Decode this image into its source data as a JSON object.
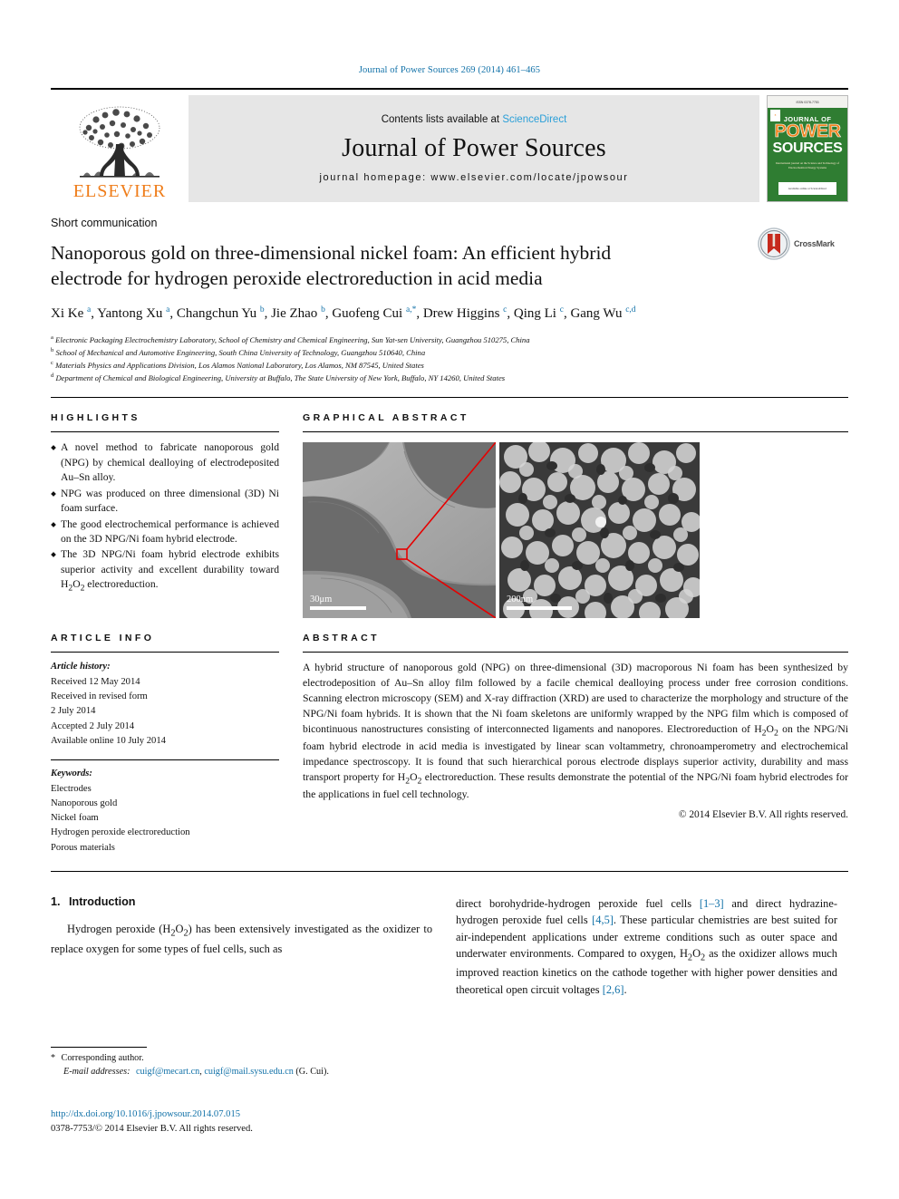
{
  "running_head": "Journal of Power Sources 269 (2014) 461–465",
  "masthead": {
    "contents_prefix": "Contents lists available at ",
    "sciencedirect": "ScienceDirect",
    "journal_name": "Journal of Power Sources",
    "homepage": "journal homepage: www.elsevier.com/locate/jpowsour",
    "publisher_logo_text": "ELSEVIER",
    "tree_icon": "elsevier-tree-icon",
    "cover": {
      "top_text": "ISSN 0378-7753",
      "line1": "JOURNAL OF",
      "line2": "POWER",
      "line3": "SOURCES",
      "blurb": "International journal on the Science and Technology of Electrochemical Energy Systems",
      "footer": "Available online at ScienceDirect"
    }
  },
  "article": {
    "doctype": "Short communication",
    "title": "Nanoporous gold on three-dimensional nickel foam: An efficient hybrid electrode for hydrogen peroxide electroreduction in acid media",
    "crossmark_label": "CrossMark",
    "authors": [
      {
        "name": "Xi Ke",
        "sup": "a",
        "sep": ", "
      },
      {
        "name": "Yantong Xu",
        "sup": "a",
        "sep": ", "
      },
      {
        "name": "Changchun Yu",
        "sup": "b",
        "sep": ", "
      },
      {
        "name": "Jie Zhao",
        "sup": "b",
        "sep": ", "
      },
      {
        "name": "Guofeng Cui",
        "sup": "a,*",
        "sep": ", "
      },
      {
        "name": "Drew Higgins",
        "sup": "c",
        "sep": ", "
      },
      {
        "name": "Qing Li",
        "sup": "c",
        "sep": ", "
      },
      {
        "name": "Gang Wu",
        "sup": "c,d",
        "sep": ""
      }
    ],
    "affiliations": [
      {
        "sup": "a",
        "text": "Electronic Packaging Electrochemistry Laboratory, School of Chemistry and Chemical Engineering, Sun Yat-sen University, Guangzhou 510275, China"
      },
      {
        "sup": "b",
        "text": "School of Mechanical and Automotive Engineering, South China University of Technology, Guangzhou 510640, China"
      },
      {
        "sup": "c",
        "text": "Materials Physics and Applications Division, Los Alamos National Laboratory, Los Alamos, NM 87545, United States"
      },
      {
        "sup": "d",
        "text": "Department of Chemical and Biological Engineering, University at Buffalo, The State University of New York, Buffalo, NY 14260, United States"
      }
    ]
  },
  "highlights": {
    "heading": "HIGHLIGHTS",
    "items": [
      "A novel method to fabricate nanoporous gold (NPG) by chemical dealloying of electrodeposited Au–Sn alloy.",
      "NPG was produced on three dimensional (3D) Ni foam surface.",
      "The good electrochemical performance is achieved on the 3D NPG/Ni foam hybrid electrode.",
      "The 3D NPG/Ni foam hybrid electrode exhibits superior activity and excellent durability toward H2O2 electroreduction."
    ]
  },
  "graphical_abstract": {
    "heading": "GRAPHICAL ABSTRACT",
    "left_image_name": "sem-ni-foam-skeleton",
    "right_image_name": "sem-nanoporous-gold",
    "left_scale": "30μm",
    "right_scale": "200nm",
    "callout_color": "#e60000"
  },
  "article_info": {
    "heading": "ARTICLE INFO",
    "history_label": "Article history:",
    "history": [
      "Received 12 May 2014",
      "Received in revised form",
      "2 July 2014",
      "Accepted 2 July 2014",
      "Available online 10 July 2014"
    ],
    "keywords_label": "Keywords:",
    "keywords": [
      "Electrodes",
      "Nanoporous gold",
      "Nickel foam",
      "Hydrogen peroxide electroreduction",
      "Porous materials"
    ]
  },
  "abstract": {
    "heading": "ABSTRACT",
    "text": "A hybrid structure of nanoporous gold (NPG) on three-dimensional (3D) macroporous Ni foam has been synthesized by electrodeposition of Au–Sn alloy film followed by a facile chemical dealloying process under free corrosion conditions. Scanning electron microscopy (SEM) and X-ray diffraction (XRD) are used to characterize the morphology and structure of the NPG/Ni foam hybrids. It is shown that the Ni foam skeletons are uniformly wrapped by the NPG film which is composed of bicontinuous nanostructures consisting of interconnected ligaments and nanopores. Electroreduction of H2O2 on the NPG/Ni foam hybrid electrode in acid media is investigated by linear scan voltammetry, chronoamperometry and electrochemical impedance spectroscopy. It is found that such hierarchical porous electrode displays superior activity, durability and mass transport property for H2O2 electroreduction. These results demonstrate the potential of the NPG/Ni foam hybrid electrodes for the applications in fuel cell technology.",
    "copyright": "© 2014 Elsevier B.V. All rights reserved."
  },
  "introduction": {
    "number": "1.",
    "title": "Introduction",
    "left_paragraph": "Hydrogen peroxide (H2O2) has been extensively investigated as the oxidizer to replace oxygen for some types of fuel cells, such as",
    "right_paragraph_parts": [
      {
        "type": "text",
        "value": "direct borohydride-hydrogen peroxide fuel cells "
      },
      {
        "type": "cite",
        "value": "[1–3]"
      },
      {
        "type": "text",
        "value": " and direct hydrazine-hydrogen peroxide fuel cells "
      },
      {
        "type": "cite",
        "value": "[4,5]"
      },
      {
        "type": "text",
        "value": ". These particular chemistries are best suited for air-independent applications under extreme conditions such as outer space and underwater environments. Compared to oxygen, H2O2 as the oxidizer allows much improved reaction kinetics on the cathode together with higher power densities and theoretical open circuit voltages "
      },
      {
        "type": "cite",
        "value": "[2,6]"
      },
      {
        "type": "text",
        "value": "."
      }
    ]
  },
  "footer": {
    "corresponding_marker": "*",
    "corresponding_label": "Corresponding author.",
    "email_label": "E-mail addresses:",
    "email1": "cuigf@mecart.cn",
    "email_sep": ", ",
    "email2": "cuigf@mail.sysu.edu.cn",
    "email_suffix": " (G. Cui).",
    "doi": "http://dx.doi.org/10.1016/j.jpowsour.2014.07.015",
    "issn": "0378-7753/© 2014 Elsevier B.V. All rights reserved."
  },
  "colors": {
    "link": "#1171a8",
    "elsevier_orange": "#ef7d1a",
    "sciencedirect": "#2a9fd8",
    "cover_green": "#2f7d32",
    "callout_red": "#e60000"
  }
}
